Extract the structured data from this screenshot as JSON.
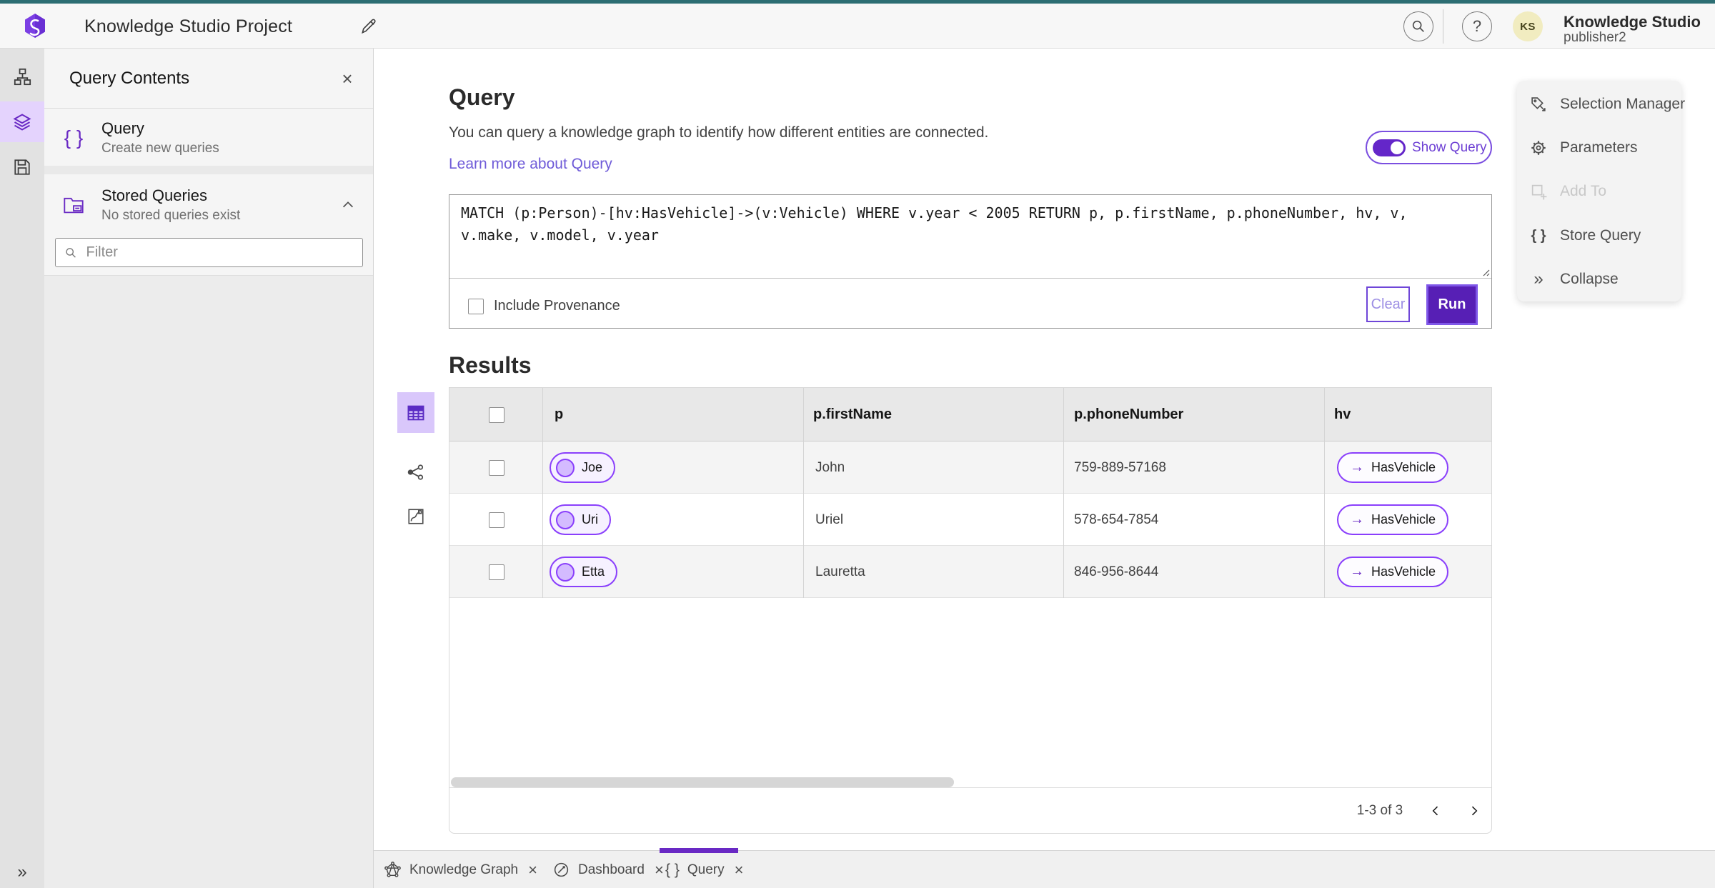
{
  "topbar": {
    "project_title": "Knowledge Studio Project",
    "user_name": "Knowledge Studio",
    "user_role": "publisher2",
    "avatar_initials": "KS"
  },
  "panel": {
    "title": "Query Contents",
    "query_item": {
      "title": "Query",
      "subtitle": "Create new queries"
    },
    "stored": {
      "title": "Stored Queries",
      "subtitle": "No stored queries exist"
    },
    "filter_placeholder": "Filter"
  },
  "query_section": {
    "title": "Query",
    "description": "You can query a knowledge graph to identify how different entities are connected.",
    "learn_more": "Learn more about Query",
    "show_query_label": "Show Query",
    "query_text": "MATCH (p:Person)-[hv:HasVehicle]->(v:Vehicle) WHERE v.year < 2005 RETURN p, p.firstName, p.phoneNumber, hv, v, v.make, v.model, v.year",
    "include_provenance_label": "Include Provenance",
    "clear_label": "Clear",
    "run_label": "Run"
  },
  "results": {
    "title": "Results",
    "columns": [
      "p",
      "p.firstName",
      "p.phoneNumber",
      "hv"
    ],
    "rows": [
      {
        "p": "Joe",
        "firstName": "John",
        "phoneNumber": "759-889-57168",
        "hv": "HasVehicle"
      },
      {
        "p": "Uri",
        "firstName": "Uriel",
        "phoneNumber": "578-654-7854",
        "hv": "HasVehicle"
      },
      {
        "p": "Etta",
        "firstName": "Lauretta",
        "phoneNumber": "846-956-8644",
        "hv": "HasVehicle"
      }
    ],
    "pagination": {
      "range": "1-3 of 3"
    }
  },
  "side_menu": {
    "items": [
      {
        "label": "Selection Manager"
      },
      {
        "label": "Parameters"
      },
      {
        "label": "Add To"
      },
      {
        "label": "Store Query"
      },
      {
        "label": "Collapse"
      }
    ]
  },
  "tabs": [
    {
      "label": "Knowledge Graph"
    },
    {
      "label": "Dashboard"
    },
    {
      "label": "Query"
    }
  ],
  "icons": {
    "braces": "{ }",
    "arrow_right": "→",
    "close": "×",
    "collapse_double": "»",
    "expand_double": "»",
    "question": "?"
  },
  "colors": {
    "accent_purple": "#6929c4",
    "teal_strip": "#2d6e73",
    "pill_border": "#8a3ffc",
    "pill_bg": "#f6f1ff",
    "selected_bg": "#e8daff",
    "link": "#6f5bd8",
    "run_bg": "#571fb5"
  }
}
